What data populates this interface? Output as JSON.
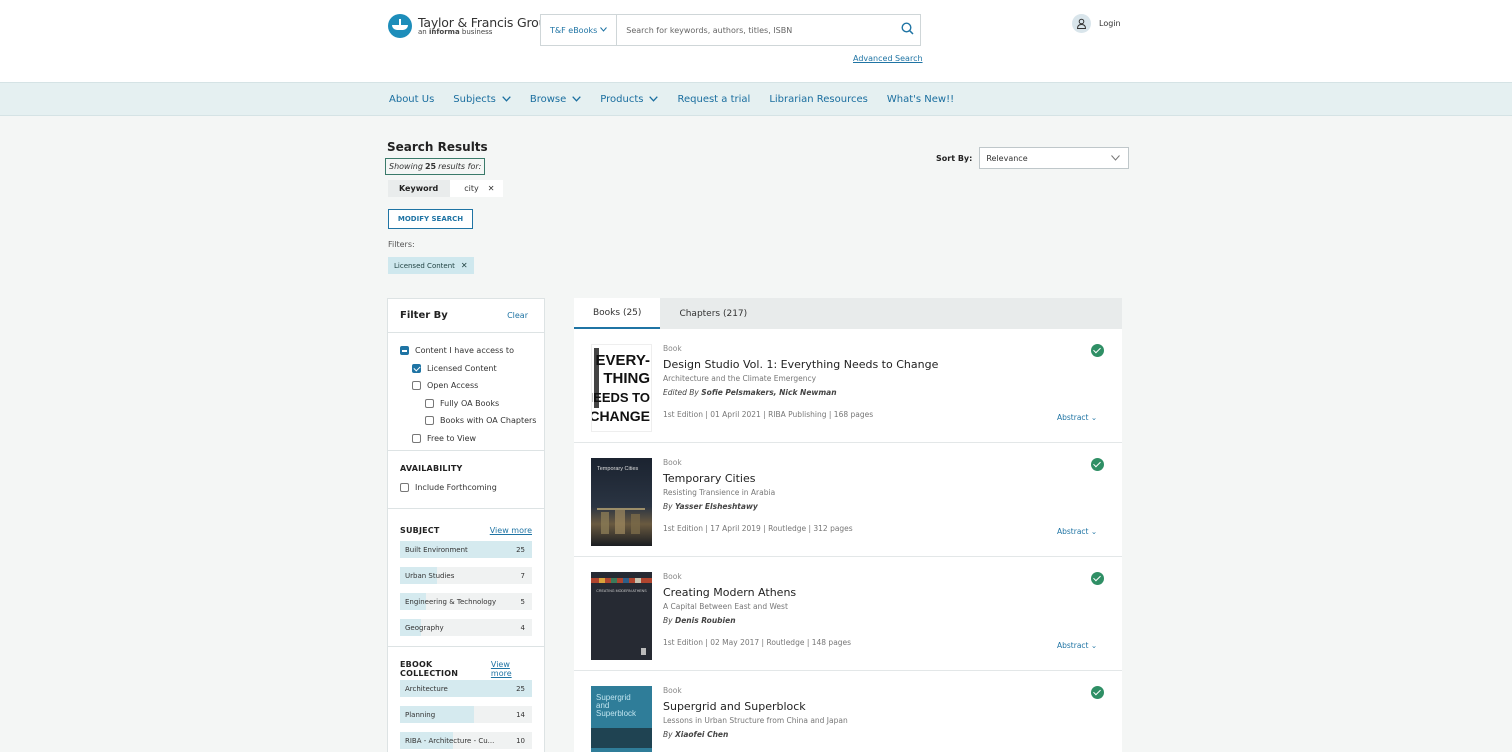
{
  "header": {
    "logo_title": "Taylor & Francis Group",
    "logo_sub_prefix": "an",
    "logo_sub_bold": "informa",
    "logo_sub_suffix": "business",
    "search_scope": "T&F eBooks",
    "search_placeholder": "Search for keywords, authors, titles, ISBN",
    "advanced_search": "Advanced Search",
    "login": "Login"
  },
  "nav": {
    "about": "About Us",
    "subjects": "Subjects",
    "browse": "Browse",
    "products": "Products",
    "trial": "Request a trial",
    "librarian": "Librarian Resources",
    "whatsnew": "What's New!!"
  },
  "search": {
    "title": "Search Results",
    "showing_prefix": "Showing",
    "count": "25",
    "showing_suffix": "results for:",
    "keyword_label": "Keyword",
    "keyword_value": "city",
    "modify": "MODIFY SEARCH",
    "filters_label": "Filters:",
    "active_filter": "Licensed Content",
    "sort_label": "Sort By:",
    "sort_value": "Relevance"
  },
  "filter_panel": {
    "title": "Filter By",
    "clear": "Clear",
    "access": [
      {
        "label": "Content I have access to",
        "state": "partial"
      },
      {
        "label": "Licensed Content",
        "state": "checked"
      },
      {
        "label": "Open Access",
        "state": "unchecked"
      },
      {
        "label": "Fully OA Books",
        "state": "unchecked"
      },
      {
        "label": "Books with OA Chapters",
        "state": "unchecked"
      },
      {
        "label": "Free to View",
        "state": "unchecked"
      }
    ],
    "availability_title": "AVAILABILITY",
    "include_forthcoming": "Include Forthcoming",
    "subject_title": "SUBJECT",
    "subject_viewmore": "View more",
    "subjects": [
      {
        "label": "Built Environment",
        "count": "25",
        "fraction": 1.0
      },
      {
        "label": "Urban Studies",
        "count": "7",
        "fraction": 0.28
      },
      {
        "label": "Engineering & Technology",
        "count": "5",
        "fraction": 0.2
      },
      {
        "label": "Geography",
        "count": "4",
        "fraction": 0.16
      }
    ],
    "collection_title": "EBOOK COLLECTION",
    "collection_viewmore": "View more",
    "collections": [
      {
        "label": "Architecture",
        "count": "25",
        "fraction": 1.0
      },
      {
        "label": "Planning",
        "count": "14",
        "fraction": 0.56
      },
      {
        "label": "RIBA - Architecture - Cu...",
        "count": "10",
        "fraction": 0.4
      }
    ]
  },
  "tabs": {
    "books": "Books (25)",
    "chapters": "Chapters (217)"
  },
  "results": [
    {
      "type": "Book",
      "title": "Design Studio Vol. 1: Everything Needs to Change",
      "subtitle": "Architecture and the Climate Emergency",
      "author_prefix": "Edited By",
      "authors": "Sofie Pelsmakers, Nick Newman",
      "pub": "1st Edition | 01 April 2021 | RIBA Publishing | 168 pages",
      "abstract": "Abstract"
    },
    {
      "type": "Book",
      "title": "Temporary Cities",
      "subtitle": "Resisting Transience in Arabia",
      "author_prefix": "By",
      "authors": "Yasser Elsheshtawy",
      "pub": "1st Edition | 17 April 2019 | Routledge | 312 pages",
      "abstract": "Abstract"
    },
    {
      "type": "Book",
      "title": "Creating Modern Athens",
      "subtitle": "A Capital Between East and West",
      "author_prefix": "By",
      "authors": "Denis Roubien",
      "pub": "1st Edition | 02 May 2017 | Routledge | 148 pages",
      "abstract": "Abstract"
    },
    {
      "type": "Book",
      "title": "Supergrid and Superblock",
      "subtitle": "Lessons in Urban Structure from China and Japan",
      "author_prefix": "By",
      "authors": "Xiaofei Chen",
      "pub": "",
      "abstract": ""
    }
  ],
  "covers": {
    "c1_lines": [
      "EVERY-",
      "THING",
      "NEEDS TO",
      "CHANGE"
    ],
    "c2_title": "Temporary Cities",
    "c3_title": "CREATING MODERN ATHENS",
    "c4_lines": [
      "Supergrid",
      "and",
      "Superblock"
    ]
  }
}
